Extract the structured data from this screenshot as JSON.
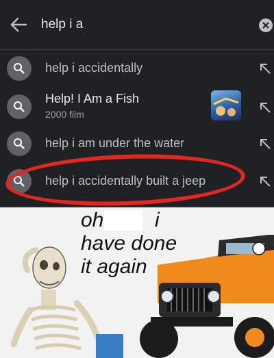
{
  "search": {
    "query": "help i a",
    "back_icon": "arrow-left-icon",
    "clear_icon": "close-circle-icon"
  },
  "suggestions": [
    {
      "typed": "help i a",
      "completion": "ccidentally",
      "display": "help i accidentally"
    },
    {
      "title": "Help! I Am a Fish",
      "subtitle": "2000 film"
    },
    {
      "typed": "help i a",
      "completion": "m under the water",
      "display": "help i am under the water"
    },
    {
      "typed": "help i a",
      "completion": "ccidentally built a jeep",
      "display": "help i accidentally built a jeep"
    }
  ],
  "meme": {
    "line1_a": "oh",
    "line1_b": "i",
    "line2": "have done",
    "line3": "it again"
  },
  "colors": {
    "background": "#202124",
    "highlight_ring": "#e3261f",
    "icon_circle": "#5f6368"
  }
}
